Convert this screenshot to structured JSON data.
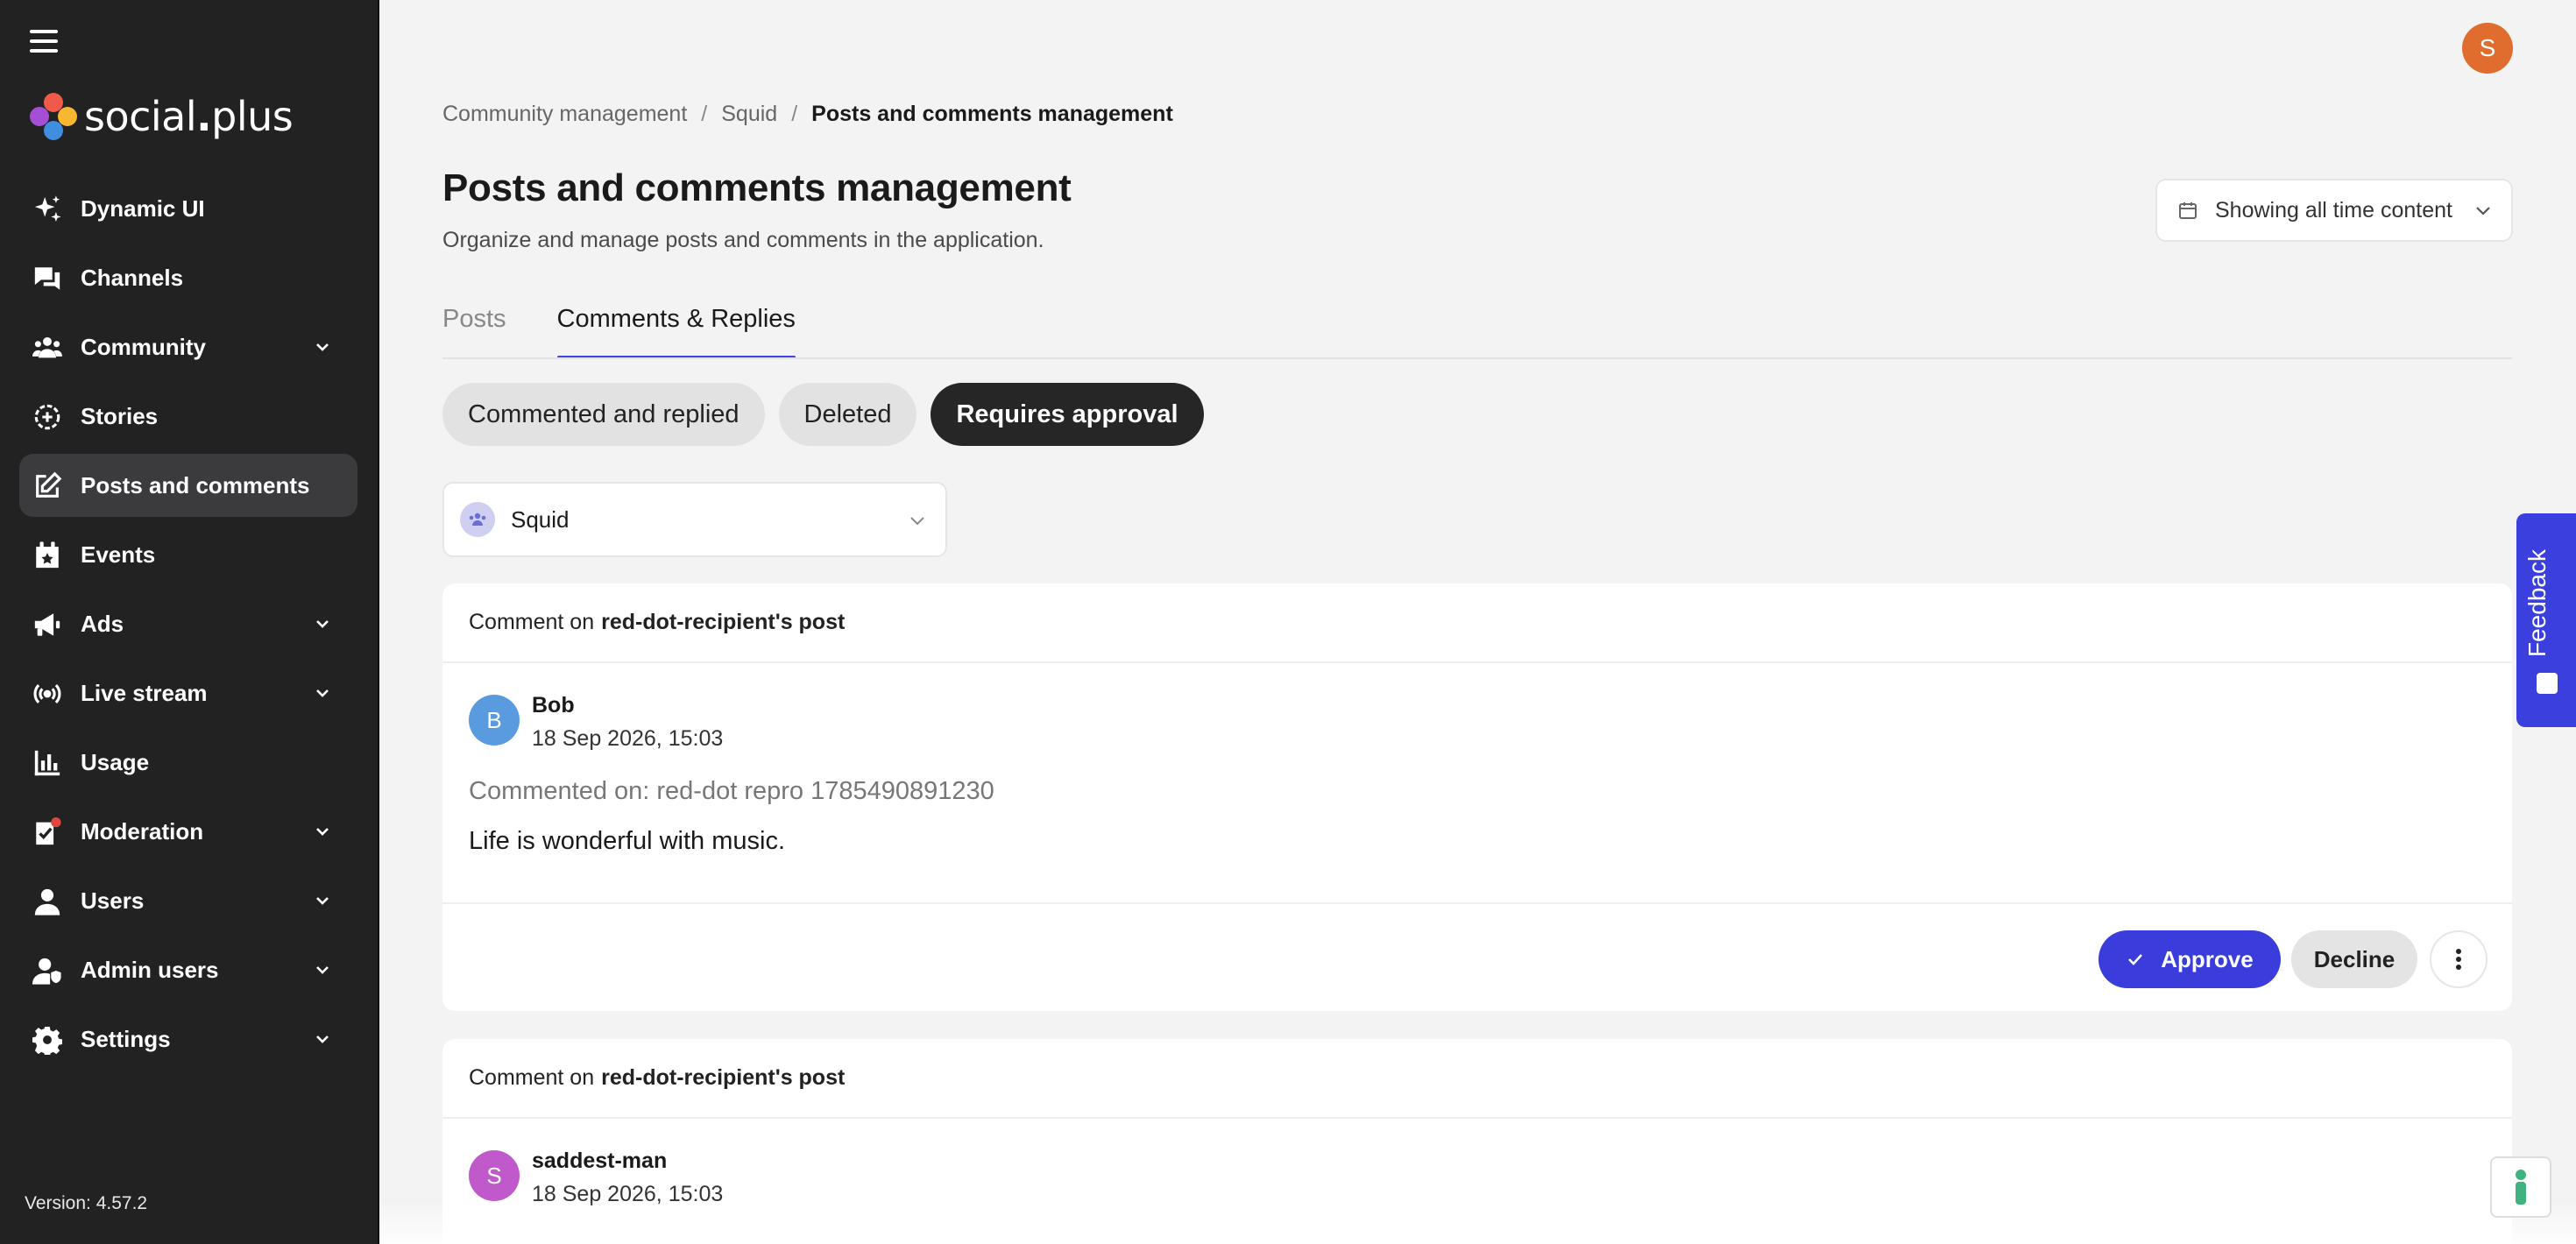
{
  "app": {
    "logo_text_main": "social",
    "logo_text_dot": ".",
    "logo_text_end": "plus",
    "version": "Version: 4.57.2",
    "user_initial": "S",
    "colors": {
      "accent": "#3a3ddc",
      "sidebar_bg": "#222223",
      "avatar": "#e06c2e"
    }
  },
  "sidebar": {
    "items": [
      {
        "label": "Dynamic UI",
        "icon": "sparkles-icon",
        "expandable": false
      },
      {
        "label": "Channels",
        "icon": "chat-bubbles-icon",
        "expandable": false
      },
      {
        "label": "Community",
        "icon": "people-icon",
        "expandable": true
      },
      {
        "label": "Stories",
        "icon": "stories-icon",
        "expandable": false
      },
      {
        "label": "Posts and comments",
        "icon": "edit-icon",
        "expandable": false,
        "active": true
      },
      {
        "label": "Events",
        "icon": "calendar-star-icon",
        "expandable": false
      },
      {
        "label": "Ads",
        "icon": "megaphone-icon",
        "expandable": true
      },
      {
        "label": "Live stream",
        "icon": "broadcast-icon",
        "expandable": true
      },
      {
        "label": "Usage",
        "icon": "bar-chart-icon",
        "expandable": false
      },
      {
        "label": "Moderation",
        "icon": "moderation-icon",
        "expandable": true
      },
      {
        "label": "Users",
        "icon": "user-icon",
        "expandable": true
      },
      {
        "label": "Admin users",
        "icon": "admin-user-icon",
        "expandable": true
      },
      {
        "label": "Settings",
        "icon": "gear-icon",
        "expandable": true
      }
    ]
  },
  "breadcrumb": {
    "items": [
      "Community management",
      "Squid",
      "Posts and comments management"
    ],
    "separator": "/"
  },
  "header": {
    "title": "Posts and comments management",
    "subtitle": "Organize and manage posts and comments in the application.",
    "time_filter": "Showing all time content"
  },
  "tabs": [
    {
      "label": "Posts",
      "active": false
    },
    {
      "label": "Comments & Replies",
      "active": true
    }
  ],
  "filters": [
    {
      "label": "Commented and replied",
      "active": false
    },
    {
      "label": "Deleted",
      "active": false
    },
    {
      "label": "Requires approval",
      "active": true
    }
  ],
  "community_select": {
    "value": "Squid"
  },
  "comments": [
    {
      "head_prefix": "Comment on",
      "head_target": "red-dot-recipient's post",
      "author_initial": "B",
      "author_name": "Bob",
      "avatar_color": "#5a9be0",
      "date": "18 Sep 2026, 15:03",
      "commented_on": "Commented on: red-dot repro 1785490891230",
      "text": "Life is wonderful with music.",
      "approve_label": "Approve",
      "decline_label": "Decline"
    },
    {
      "head_prefix": "Comment on",
      "head_target": "red-dot-recipient's post",
      "author_initial": "S",
      "author_name": "saddest-man",
      "avatar_color": "#c05acb",
      "date": "18 Sep 2026, 15:03"
    }
  ],
  "feedback": {
    "label": "Feedback"
  }
}
